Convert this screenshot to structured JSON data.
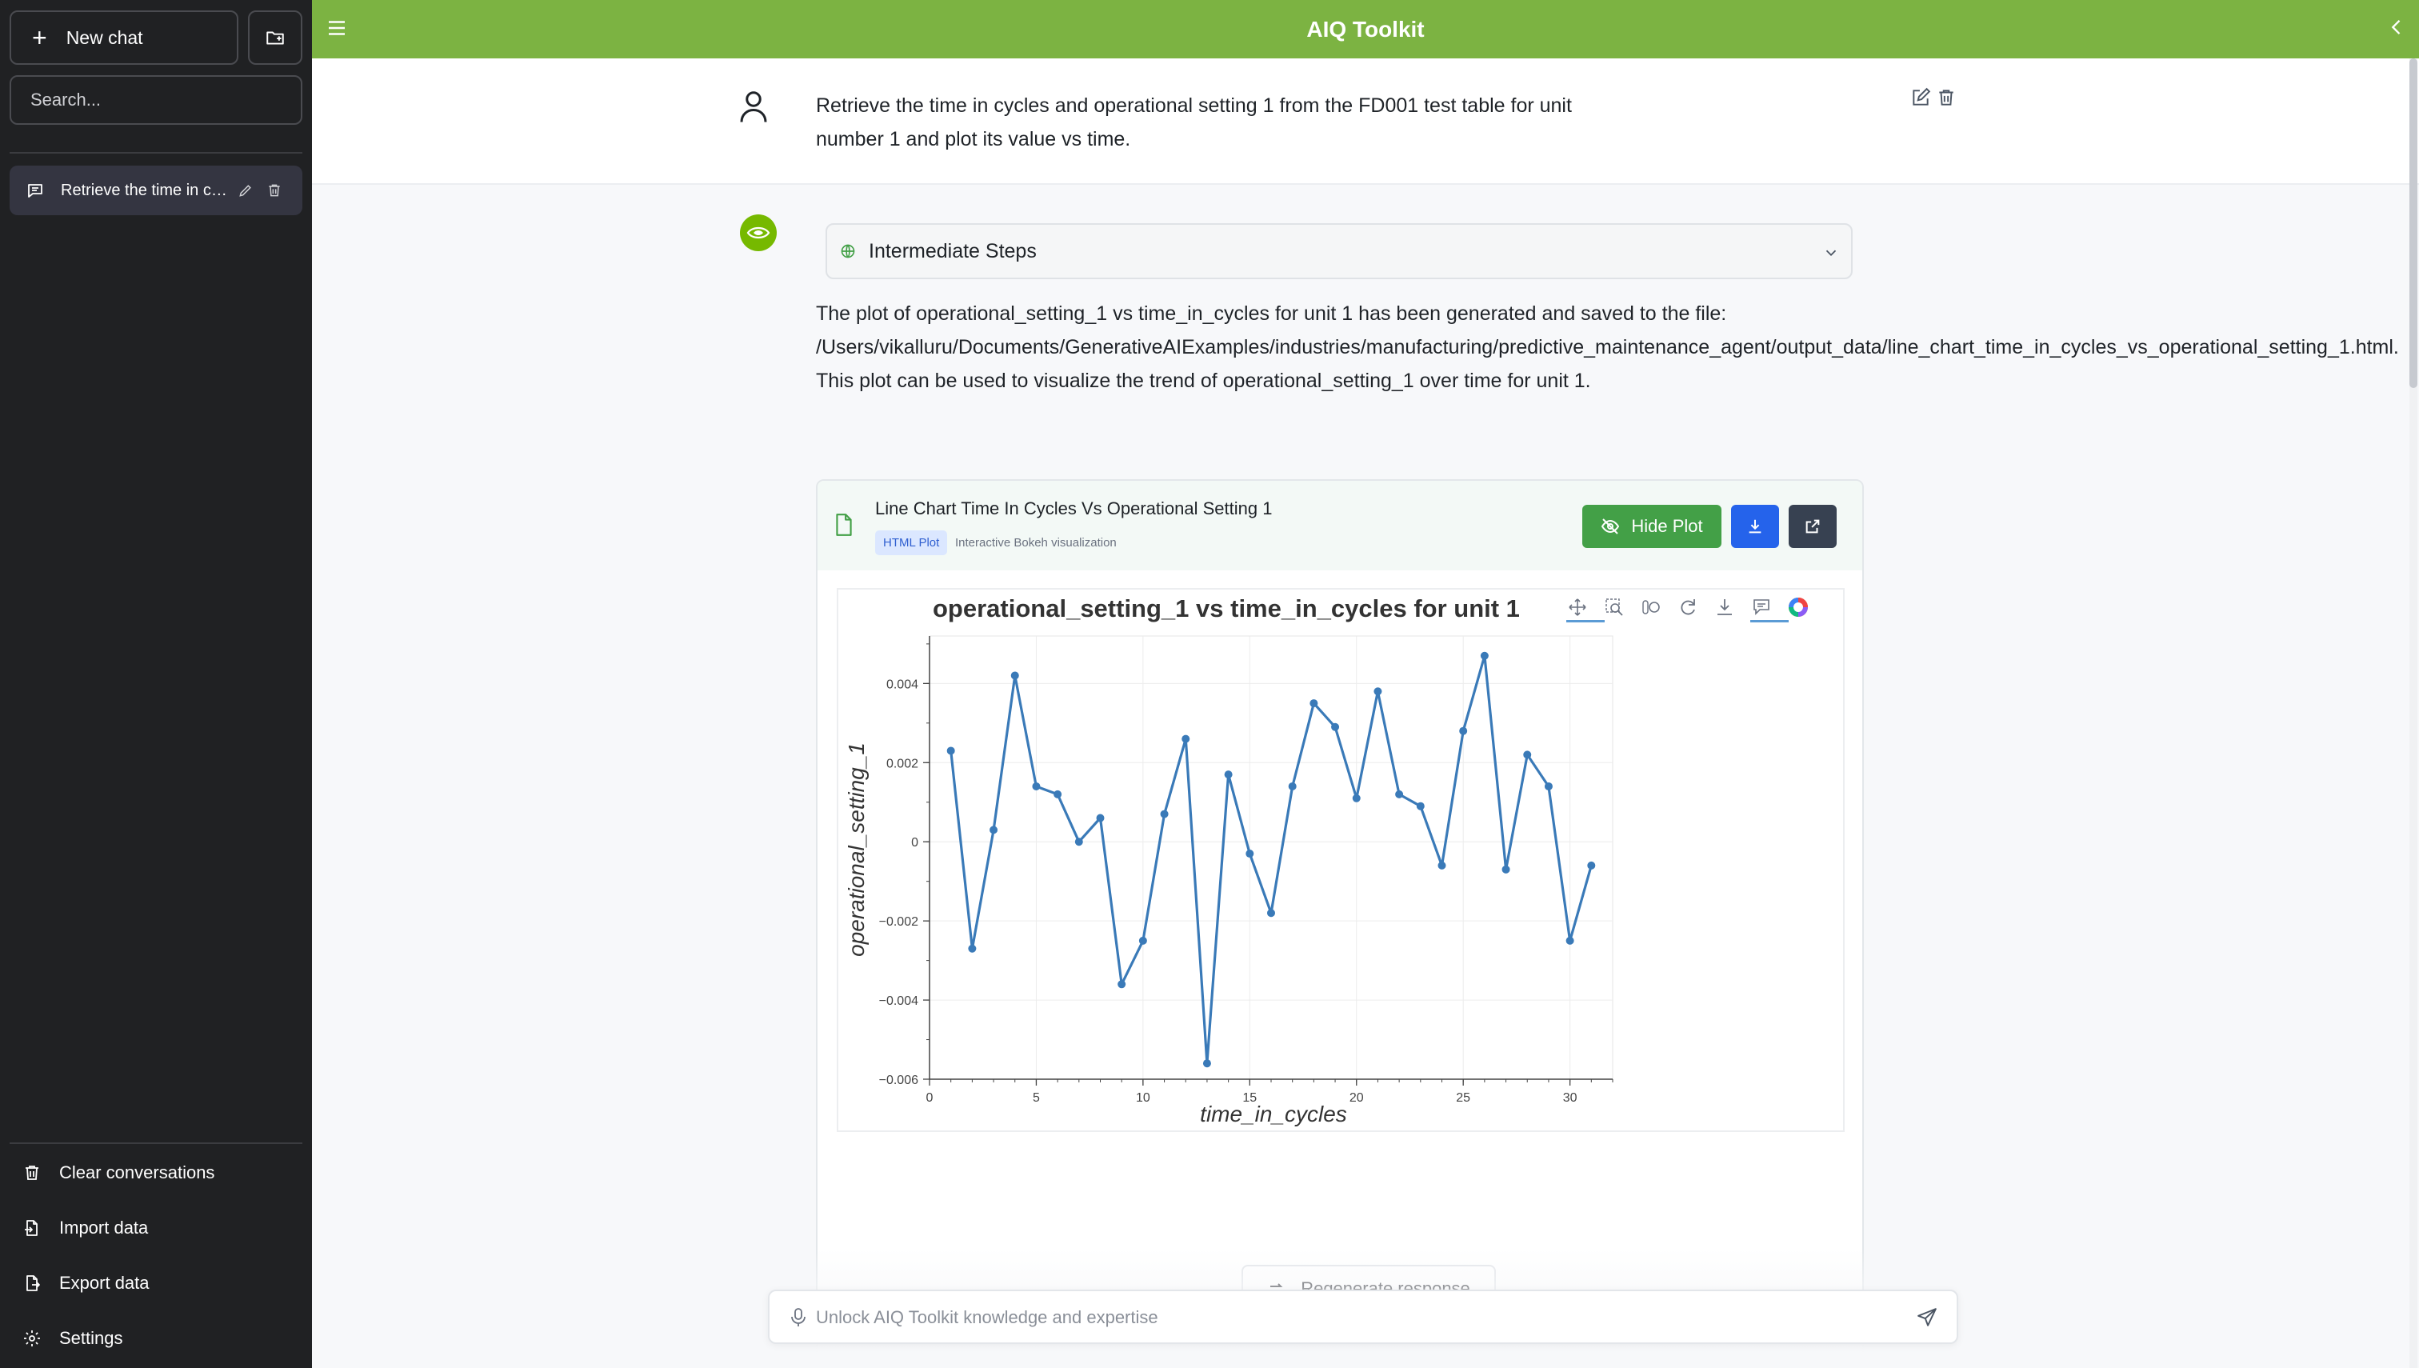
{
  "app": {
    "title": "AIQ Toolkit"
  },
  "sidebar": {
    "new_chat_label": "New chat",
    "search_placeholder": "Search...",
    "conversations": [
      {
        "label": "Retrieve the time in cycles and operational setting 1 from the FD001 test table for unit number 1 and plot its value vs time."
      }
    ],
    "actions": {
      "clear": "Clear conversations",
      "import": "Import data",
      "export": "Export data",
      "settings": "Settings"
    }
  },
  "chat": {
    "user_message": "Retrieve the time in cycles and operational setting 1 from the FD001 test table for unit number 1 and plot its value vs time.",
    "intermediate_steps_label": "Intermediate Steps",
    "bot_paragraph": "The plot of operational_setting_1 vs time_in_cycles for unit 1 has been generated and saved to the file: /Users/vikalluru/Documents/GenerativeAIExamples/industries/manufacturing/predictive_maintenance_agent/output_data/line_chart_time_in_cycles_vs_operational_setting_1.html. This plot can be used to visualize the trend of operational_setting_1 over time for unit 1.",
    "plot_card": {
      "title": "Line Chart Time In Cycles Vs Operational Setting 1",
      "badge": "HTML Plot",
      "subtitle": "Interactive Bokeh visualization",
      "hide_label": "Hide Plot"
    },
    "regenerate_label": "Regenerate response",
    "input_placeholder": "Unlock AIQ Toolkit knowledge and expertise"
  },
  "colors": {
    "header": "#7cb342",
    "sidebar": "#202123",
    "line": "#3a7ab8",
    "hide_button": "#43a047",
    "download_button": "#2563eb"
  },
  "chart_data": {
    "type": "line",
    "title": "operational_setting_1 vs time_in_cycles for unit 1",
    "xlabel": "time_in_cycles",
    "ylabel": "operational_setting_1",
    "xlim": [
      0,
      32
    ],
    "ylim": [
      -0.006,
      0.0052
    ],
    "x_ticks": [
      0,
      5,
      10,
      15,
      20,
      25,
      30
    ],
    "x_tick_labels": [
      "0",
      "5",
      "10",
      "15",
      "20",
      "25",
      "30"
    ],
    "y_ticks": [
      0.004,
      0.002,
      0,
      -0.002,
      -0.004,
      -0.006
    ],
    "y_tick_labels": [
      "0.004",
      "0.002",
      "0",
      "−0.002",
      "−0.004",
      "−0.006"
    ],
    "grid": true,
    "x": [
      1,
      2,
      3,
      4,
      5,
      6,
      7,
      8,
      9,
      10,
      11,
      12,
      13,
      14,
      15,
      16,
      17,
      18,
      19,
      20,
      21,
      22,
      23,
      24,
      25,
      26,
      27,
      28,
      29,
      30,
      31
    ],
    "values": [
      0.0023,
      -0.0027,
      0.0003,
      0.0042,
      0.0014,
      0.0012,
      -0.0,
      0.0006,
      -0.0036,
      -0.0025,
      0.0007,
      0.0026,
      -0.0056,
      0.0017,
      -0.0003,
      -0.0018,
      0.0014,
      0.0035,
      0.0029,
      0.0011,
      0.0038,
      0.0012,
      0.0009,
      -0.0006,
      0.0028,
      0.0047,
      -0.0007,
      0.0022,
      0.0014,
      -0.0025,
      -0.0006
    ]
  }
}
